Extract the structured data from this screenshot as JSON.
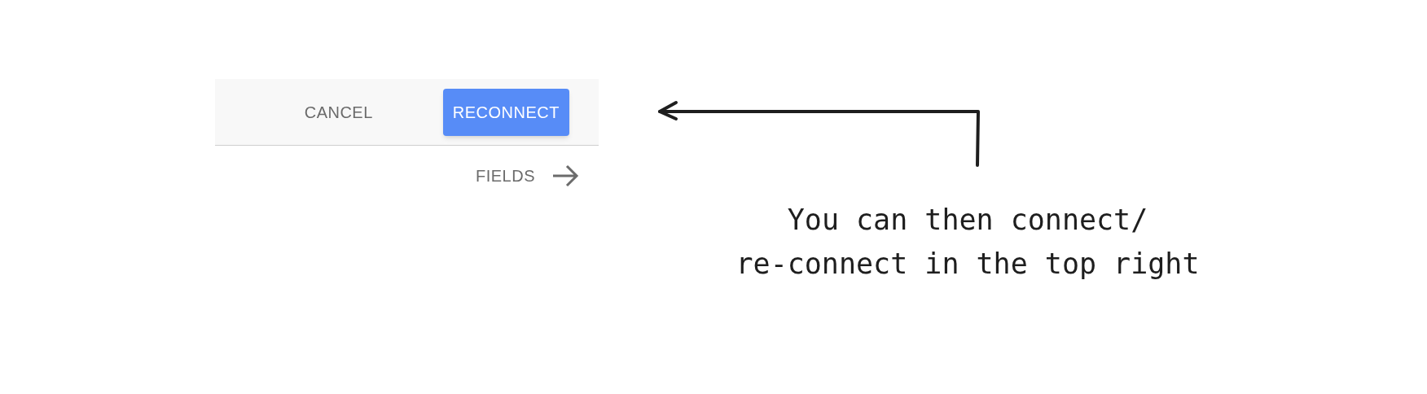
{
  "toolbar": {
    "buttons": [
      {
        "label": "CANCEL",
        "kind": "text"
      },
      {
        "label": "RECONNECT",
        "kind": "primary"
      }
    ]
  },
  "fields_link": {
    "label": "FIELDS"
  },
  "annotation": {
    "lines": [
      "You can then connect/",
      "re-connect in the top right"
    ]
  }
}
